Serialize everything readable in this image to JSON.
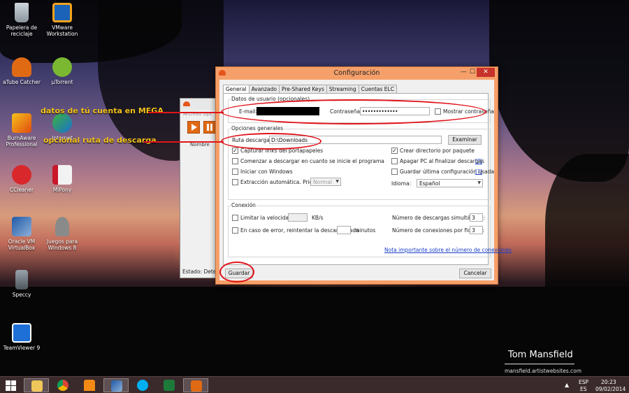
{
  "desktop": {
    "icons": [
      {
        "id": "recycle",
        "label": "Papelera de reciclaje",
        "icon": "recycle-bin-icon"
      },
      {
        "id": "vmware",
        "label": "VMware Workstation",
        "icon": "vmware-icon"
      },
      {
        "id": "atube",
        "label": "aTube Catcher",
        "icon": "atube-icon"
      },
      {
        "id": "utorrent",
        "label": "µTorrent",
        "icon": "utorrent-icon"
      },
      {
        "id": "burnaware",
        "label": "BurnAware Professional",
        "icon": "burnaware-icon"
      },
      {
        "id": "internet",
        "label": "Internet",
        "icon": "internet-icon"
      },
      {
        "id": "ccleaner",
        "label": "CCleaner",
        "icon": "ccleaner-icon"
      },
      {
        "id": "mipony",
        "label": "MiPony",
        "icon": "mipony-icon"
      },
      {
        "id": "virtualbox",
        "label": "Oracle VM VirtualBox",
        "icon": "virtualbox-icon"
      },
      {
        "id": "juegos",
        "label": "Juegos para Windows 8",
        "icon": "games-icon"
      },
      {
        "id": "speccy",
        "label": "Speccy",
        "icon": "speccy-icon"
      },
      {
        "id": "teamviewer",
        "label": "TeamViewer 9",
        "icon": "teamviewer-icon"
      }
    ]
  },
  "annotations": {
    "mega": "datos de tú cuenta en MEGA",
    "ruta": "opcional ruta de descarga"
  },
  "bg_window": {
    "menu": "Archivo  Opc",
    "column": "Nombre",
    "status": "Estado: Detenido"
  },
  "window": {
    "title": "Configuración",
    "min": "—",
    "max": "☐",
    "close": "✕",
    "tabs": [
      "General",
      "Avanzado",
      "Pre-Shared Keys",
      "Streaming",
      "Cuentas ELC"
    ],
    "active_tab": "General",
    "user_group": {
      "title": "Datos de usuario (opcionales)",
      "email_label": "E-mail:",
      "email_value": "",
      "password_label": "Contraseña:",
      "password_value": "•••••••••••••",
      "show_password": "Mostrar contraseña"
    },
    "general_group": {
      "title": "Opciones generales",
      "download_path_label": "Ruta descargas:",
      "download_path_value": "D:\\Downloads",
      "browse": "Examinar",
      "left_options": [
        {
          "label": "Capturar links del portapapeles",
          "checked": true
        },
        {
          "label": "Comenzar a descargar en cuanto se inicie el programa",
          "checked": false
        },
        {
          "label": "Iniciar con Windows",
          "checked": false
        },
        {
          "label": "Extracción automática. Prioridad:",
          "checked": false
        }
      ],
      "priority_value": "Normal",
      "right_options": [
        {
          "label": "Crear directorio por paquete",
          "checked": true
        },
        {
          "label": "Apagar PC al finalizar descargas",
          "checked": false,
          "help": "[?]"
        },
        {
          "label": "Guardar última configuración usada",
          "checked": false,
          "help": "[?]"
        }
      ],
      "language_label": "Idioma:",
      "language_value": "Español"
    },
    "connection_group": {
      "title": "Conexión",
      "limit_label": "Limitar la velocidad a",
      "limit_value": "",
      "limit_unit": "KB/s",
      "retry_label": "En caso de error, reintentar la descarga cada",
      "retry_value": "",
      "retry_unit": "minutos",
      "simul_label": "Número de descargas simultáneas:",
      "simul_value": "3",
      "conn_label": "Número de conexiones por fichero:",
      "conn_value": "3",
      "note_link": "Nota importante sobre el número de conexiones"
    },
    "save": "Guardar",
    "cancel": "Cancelar"
  },
  "watermark": {
    "name": "Tom Mansfield",
    "url": "mansfield.artistwebsites.com"
  },
  "taskbar": {
    "apps": [
      "start-icon",
      "file-explorer-icon",
      "chrome-icon",
      "vlc-icon",
      "virtualbox-icon",
      "skype-icon",
      "excel-icon",
      "mipony-icon"
    ],
    "lang_top": "ESP",
    "lang_bottom": "ES",
    "time": "20:23",
    "date": "09/02/2014"
  },
  "colors": {
    "annotation_red": "#e0141b",
    "annotation_yellow": "#f2c21a",
    "window_frame": "#f5a06a",
    "close_red": "#c7322a",
    "link_blue": "#1a3ec8"
  }
}
